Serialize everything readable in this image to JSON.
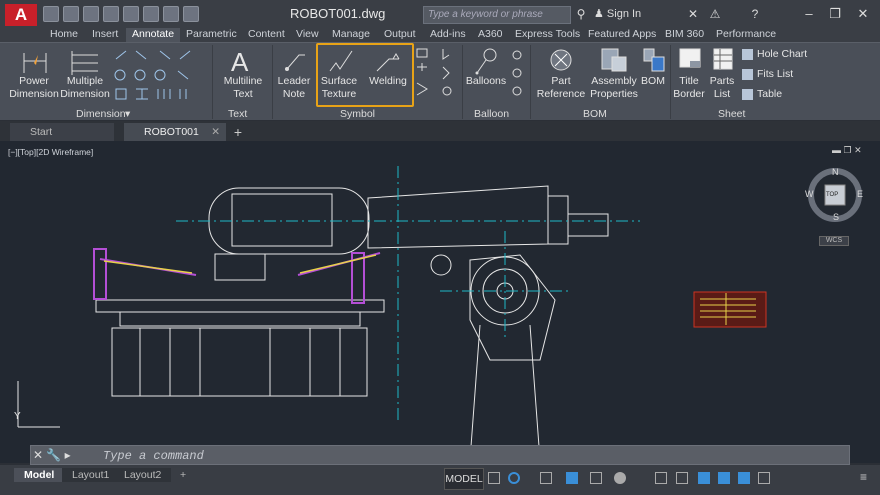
{
  "title_bar": {
    "app_logo": "A",
    "document_title": "ROBOT001.dwg",
    "search_placeholder": "Type a keyword or phrase",
    "sign_in_label": "Sign In"
  },
  "ribbon_tabs": [
    "Home",
    "Insert",
    "Annotate",
    "Parametric",
    "Content",
    "View",
    "Manage",
    "Output",
    "Add-ins",
    "A360",
    "Express Tools",
    "Featured Apps",
    "BIM 360",
    "Performance"
  ],
  "ribbon_active_tab": "Annotate",
  "ribbon": {
    "dimension": {
      "power_dimension": "Power\nDimension",
      "multiple_dimension": "Multiple\nDimension",
      "panel_title": "Dimension"
    },
    "text": {
      "multiline_text": "Multiline\nText",
      "panel_title": "Text"
    },
    "symbol": {
      "leader_note": "Leader\nNote",
      "surface_texture": "Surface\nTexture",
      "welding": "Welding",
      "panel_title": "Symbol"
    },
    "balloon": {
      "balloons": "Balloons",
      "panel_title": "Balloon"
    },
    "bom": {
      "part_reference": "Part\nReference",
      "assembly_properties": "Assembly\nProperties",
      "bom_button": "BOM",
      "panel_title": "BOM"
    },
    "sheet": {
      "title_border": "Title\nBorder",
      "parts_list": "Parts\nList",
      "hole_chart": "Hole Chart",
      "fits_list": "Fits List",
      "table": "Table",
      "panel_title": "Sheet"
    }
  },
  "file_tabs": {
    "start": "Start",
    "active": "ROBOT001"
  },
  "viewport": {
    "label": "[−][Top][2D Wireframe]",
    "viewcube_face": "TOP",
    "compass": {
      "n": "N",
      "s": "S",
      "e": "E",
      "w": "W"
    },
    "ucs_label": "WCS",
    "axis_y": "Y"
  },
  "command_line": {
    "placeholder": "Type a command"
  },
  "layout_tabs": [
    "Model",
    "Layout1",
    "Layout2"
  ],
  "status_bar": {
    "model_label": "MODEL"
  },
  "colors": {
    "accent_highlight": "#e8a317",
    "geometry": "#e6e6e6",
    "centerline": "#1fb8c6",
    "purple": "#b44fd6",
    "title_block": "#cc3322"
  }
}
